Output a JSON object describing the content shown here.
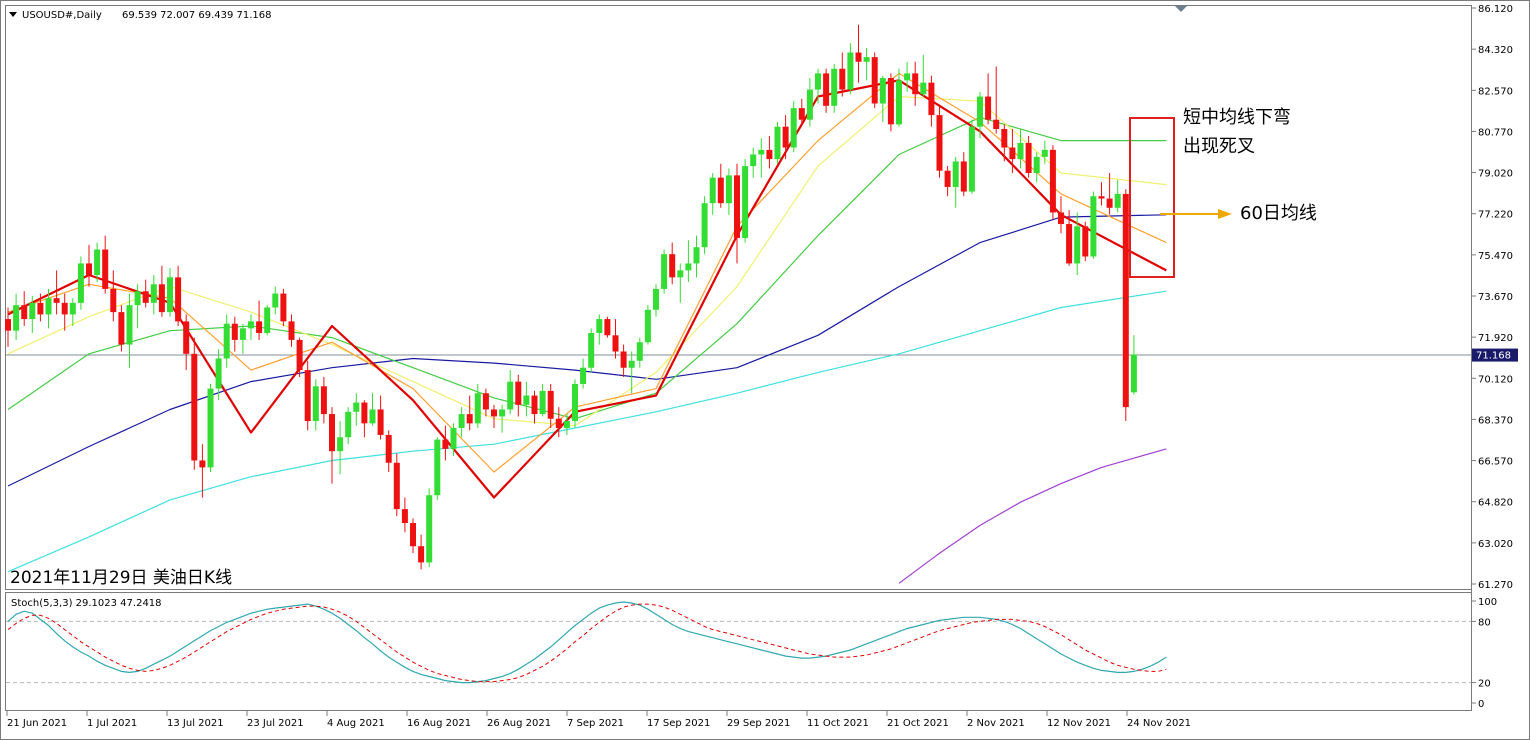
{
  "header": {
    "symbol": "USOUSD#,Daily",
    "ohlc": "69.539 72.007 69.439 71.168"
  },
  "caption": "2021年11月29日 美油日K线",
  "annotations": {
    "box_text_1": "短中均线下弯",
    "box_text_2": "出现死叉",
    "arrow_text": "60日均线"
  },
  "indicator": {
    "label": "Stoch(5,3,3) 29.1023 47.2418",
    "ticks": [
      "100",
      "80",
      "20",
      "0"
    ]
  },
  "price_axis": {
    "ticks": [
      "86.120",
      "84.320",
      "82.570",
      "80.770",
      "79.020",
      "77.220",
      "75.470",
      "73.670",
      "71.920",
      "70.120",
      "68.370",
      "66.570",
      "64.820",
      "63.020",
      "61.270"
    ],
    "current": "71.168"
  },
  "date_axis": {
    "ticks": [
      "21 Jun 2021",
      "1 Jul 2021",
      "13 Jul 2021",
      "23 Jul 2021",
      "4 Aug 2021",
      "16 Aug 2021",
      "26 Aug 2021",
      "7 Sep 2021",
      "17 Sep 2021",
      "29 Sep 2021",
      "11 Oct 2021",
      "21 Oct 2021",
      "2 Nov 2021",
      "12 Nov 2021",
      "24 Nov 2021"
    ]
  },
  "colors": {
    "bull": "#33dd33",
    "bear": "#ee1111",
    "ma5": "#e00000",
    "ma10": "#ffa030",
    "ma20": "#f0f070",
    "ma30": "#44cc44",
    "ma60": "#1a1aa0",
    "ma120": "#40e0e0",
    "ma250": "#a040d0",
    "stoch_main": "#30a8b0",
    "stoch_signal": "#e00000",
    "box": "#e02020",
    "arrow": "#f0a800"
  },
  "chart_data": {
    "type": "candlestick",
    "symbol": "USOUSD#",
    "timeframe": "Daily",
    "last_bar": {
      "open": 69.539,
      "high": 72.007,
      "low": 69.439,
      "close": 71.168
    },
    "ylim": [
      61.27,
      86.12
    ],
    "candles": [
      [
        72.7,
        73.2,
        71.5,
        72.2
      ],
      [
        72.2,
        73.8,
        71.8,
        73.3
      ],
      [
        73.3,
        73.9,
        72.4,
        72.7
      ],
      [
        72.7,
        73.7,
        72.1,
        73.4
      ],
      [
        73.4,
        73.8,
        72.6,
        72.9
      ],
      [
        72.9,
        74.0,
        72.3,
        73.6
      ],
      [
        73.6,
        74.8,
        72.9,
        73.4
      ],
      [
        73.4,
        73.8,
        72.2,
        72.9
      ],
      [
        72.9,
        73.6,
        72.4,
        73.4
      ],
      [
        73.4,
        75.4,
        73.1,
        75.1
      ],
      [
        75.1,
        75.9,
        74.1,
        74.6
      ],
      [
        74.6,
        76.0,
        74.3,
        75.7
      ],
      [
        75.7,
        76.3,
        73.8,
        74.0
      ],
      [
        74.0,
        74.8,
        72.6,
        73.0
      ],
      [
        73.0,
        73.3,
        71.3,
        71.6
      ],
      [
        71.6,
        73.8,
        70.6,
        73.3
      ],
      [
        73.3,
        74.2,
        72.3,
        73.9
      ],
      [
        73.9,
        74.4,
        73.2,
        73.4
      ],
      [
        73.4,
        74.6,
        72.9,
        74.2
      ],
      [
        74.2,
        75.0,
        72.8,
        73.0
      ],
      [
        73.0,
        74.9,
        72.8,
        74.5
      ],
      [
        74.5,
        75.0,
        72.4,
        72.6
      ],
      [
        72.6,
        72.9,
        70.5,
        71.2
      ],
      [
        71.2,
        71.9,
        66.2,
        66.6
      ],
      [
        66.6,
        67.3,
        65.0,
        66.3
      ],
      [
        66.3,
        69.9,
        66.1,
        69.7
      ],
      [
        69.7,
        71.4,
        69.2,
        71.0
      ],
      [
        71.0,
        72.9,
        70.6,
        72.5
      ],
      [
        72.5,
        72.8,
        71.3,
        71.8
      ],
      [
        71.8,
        72.5,
        71.2,
        72.3
      ],
      [
        72.3,
        72.9,
        71.8,
        72.6
      ],
      [
        72.6,
        73.5,
        71.8,
        72.1
      ],
      [
        72.1,
        73.3,
        72.0,
        73.2
      ],
      [
        73.2,
        74.1,
        72.9,
        73.8
      ],
      [
        73.8,
        74.0,
        72.4,
        72.6
      ],
      [
        72.6,
        72.9,
        71.5,
        71.8
      ],
      [
        71.8,
        71.9,
        70.2,
        70.5
      ],
      [
        70.5,
        70.9,
        67.9,
        68.3
      ],
      [
        68.3,
        70.1,
        67.9,
        69.8
      ],
      [
        69.8,
        70.2,
        68.2,
        68.6
      ],
      [
        68.6,
        68.9,
        65.6,
        67.0
      ],
      [
        67.0,
        68.3,
        66.0,
        67.6
      ],
      [
        67.6,
        68.9,
        67.3,
        68.7
      ],
      [
        68.7,
        69.5,
        68.1,
        69.1
      ],
      [
        69.1,
        69.2,
        67.6,
        68.2
      ],
      [
        68.2,
        69.5,
        68.1,
        68.8
      ],
      [
        68.8,
        69.4,
        67.5,
        67.7
      ],
      [
        67.7,
        67.9,
        66.1,
        66.5
      ],
      [
        66.5,
        66.9,
        64.2,
        64.5
      ],
      [
        64.5,
        65.0,
        63.5,
        63.9
      ],
      [
        63.9,
        64.1,
        62.6,
        62.9
      ],
      [
        62.9,
        63.4,
        61.9,
        62.2
      ],
      [
        62.2,
        65.4,
        62.0,
        65.1
      ],
      [
        65.1,
        67.6,
        64.9,
        67.5
      ],
      [
        67.5,
        68.1,
        66.6,
        67.1
      ],
      [
        67.1,
        68.2,
        66.8,
        68.0
      ],
      [
        68.0,
        68.9,
        67.6,
        68.6
      ],
      [
        68.6,
        69.4,
        67.9,
        68.2
      ],
      [
        68.2,
        69.9,
        68.0,
        69.5
      ],
      [
        69.5,
        69.7,
        68.5,
        68.8
      ],
      [
        68.8,
        69.0,
        68.0,
        68.5
      ],
      [
        68.5,
        69.0,
        67.8,
        68.8
      ],
      [
        68.8,
        70.5,
        68.6,
        70.0
      ],
      [
        70.0,
        70.3,
        68.5,
        69.0
      ],
      [
        69.0,
        70.0,
        68.5,
        69.4
      ],
      [
        69.4,
        69.6,
        68.2,
        68.6
      ],
      [
        68.6,
        69.9,
        68.5,
        69.6
      ],
      [
        69.6,
        69.9,
        68.0,
        68.4
      ],
      [
        68.4,
        68.9,
        67.6,
        68.0
      ],
      [
        68.0,
        68.6,
        67.7,
        68.3
      ],
      [
        68.3,
        70.1,
        68.0,
        69.9
      ],
      [
        69.9,
        71.0,
        69.7,
        70.6
      ],
      [
        70.6,
        72.3,
        70.4,
        72.1
      ],
      [
        72.1,
        72.9,
        71.6,
        72.7
      ],
      [
        72.7,
        72.8,
        71.9,
        72.0
      ],
      [
        72.0,
        72.7,
        71.0,
        71.3
      ],
      [
        71.3,
        71.6,
        70.2,
        70.6
      ],
      [
        70.6,
        71.3,
        69.5,
        70.9
      ],
      [
        70.9,
        71.9,
        70.6,
        71.7
      ],
      [
        71.7,
        73.3,
        71.6,
        73.1
      ],
      [
        73.1,
        74.2,
        72.8,
        74.0
      ],
      [
        74.0,
        75.7,
        73.8,
        75.5
      ],
      [
        75.5,
        76.0,
        74.2,
        74.5
      ],
      [
        74.5,
        75.1,
        73.4,
        74.8
      ],
      [
        74.8,
        76.1,
        74.3,
        75.1
      ],
      [
        75.1,
        76.3,
        74.5,
        75.8
      ],
      [
        75.8,
        78.0,
        75.5,
        77.7
      ],
      [
        77.7,
        79.0,
        77.2,
        78.8
      ],
      [
        78.8,
        79.4,
        77.5,
        77.7
      ],
      [
        77.7,
        79.2,
        77.2,
        78.9
      ],
      [
        78.9,
        79.4,
        75.1,
        76.2
      ],
      [
        76.2,
        79.6,
        76.0,
        79.3
      ],
      [
        79.3,
        80.1,
        78.8,
        79.8
      ],
      [
        79.8,
        80.5,
        78.8,
        80.0
      ],
      [
        80.0,
        80.6,
        79.2,
        79.6
      ],
      [
        79.6,
        81.2,
        79.4,
        81.0
      ],
      [
        81.0,
        81.5,
        79.6,
        80.1
      ],
      [
        80.1,
        82.1,
        79.9,
        81.8
      ],
      [
        81.8,
        82.2,
        81.1,
        81.3
      ],
      [
        81.3,
        83.1,
        81.0,
        82.6
      ],
      [
        82.6,
        83.5,
        82.0,
        83.3
      ],
      [
        83.3,
        83.5,
        81.6,
        81.9
      ],
      [
        81.9,
        83.7,
        81.6,
        83.5
      ],
      [
        83.5,
        84.2,
        82.3,
        82.6
      ],
      [
        82.6,
        84.6,
        82.4,
        84.2
      ],
      [
        84.2,
        85.4,
        82.9,
        83.8
      ],
      [
        83.8,
        84.4,
        83.0,
        84.0
      ],
      [
        84.0,
        84.2,
        81.8,
        82.0
      ],
      [
        82.0,
        83.2,
        81.2,
        83.1
      ],
      [
        83.1,
        83.3,
        80.8,
        81.1
      ],
      [
        81.1,
        83.5,
        81.0,
        83.0
      ],
      [
        83.0,
        83.8,
        82.5,
        83.3
      ],
      [
        83.3,
        83.8,
        81.9,
        82.4
      ],
      [
        82.4,
        84.1,
        82.3,
        82.9
      ],
      [
        82.9,
        83.2,
        81.0,
        81.5
      ],
      [
        81.5,
        81.9,
        78.8,
        79.1
      ],
      [
        79.1,
        79.3,
        78.0,
        78.4
      ],
      [
        78.4,
        79.7,
        77.5,
        79.5
      ],
      [
        79.5,
        79.9,
        78.0,
        78.2
      ],
      [
        78.2,
        81.3,
        78.1,
        81.0
      ],
      [
        81.0,
        82.5,
        80.5,
        82.3
      ],
      [
        82.3,
        83.3,
        81.1,
        81.3
      ],
      [
        81.3,
        83.6,
        80.7,
        80.9
      ],
      [
        80.9,
        81.1,
        79.5,
        80.1
      ],
      [
        80.1,
        80.9,
        79.0,
        79.6
      ],
      [
        79.6,
        80.9,
        79.2,
        80.3
      ],
      [
        80.3,
        80.6,
        78.8,
        79.0
      ],
      [
        79.0,
        79.9,
        78.6,
        79.7
      ],
      [
        79.7,
        80.4,
        79.4,
        80.0
      ],
      [
        80.0,
        80.2,
        77.0,
        77.3
      ],
      [
        77.3,
        78.0,
        76.4,
        76.8
      ],
      [
        76.8,
        77.4,
        75.0,
        75.1
      ],
      [
        75.1,
        77.3,
        74.6,
        76.7
      ],
      [
        76.7,
        76.9,
        75.2,
        75.4
      ],
      [
        75.4,
        78.2,
        75.3,
        78.0
      ],
      [
        78.0,
        78.6,
        77.6,
        77.9
      ],
      [
        77.9,
        79.0,
        77.2,
        77.5
      ],
      [
        77.5,
        78.7,
        77.3,
        78.1
      ],
      [
        78.1,
        78.3,
        68.3,
        68.9
      ],
      [
        69.539,
        72.007,
        69.439,
        71.168
      ]
    ],
    "moving_averages": [
      {
        "label": "5",
        "x": [
          0,
          10,
          20,
          30,
          40,
          50,
          60,
          70,
          80,
          90,
          100,
          110,
          120,
          130,
          143
        ],
        "y": [
          72.9,
          74.6,
          73.4,
          67.8,
          72.4,
          69.2,
          65.0,
          68.7,
          69.4,
          76.3,
          82.3,
          83.0,
          80.8,
          77.2,
          74.8
        ]
      },
      {
        "label": "10",
        "x": [
          0,
          10,
          20,
          30,
          40,
          50,
          60,
          70,
          80,
          90,
          100,
          110,
          120,
          130,
          143
        ],
        "y": [
          73.0,
          74.2,
          73.6,
          70.5,
          71.7,
          69.7,
          66.1,
          68.9,
          69.7,
          76.7,
          80.4,
          83.3,
          81.2,
          78.1,
          76.0
        ]
      },
      {
        "label": "20",
        "x": [
          0,
          10,
          20,
          30,
          40,
          50,
          60,
          70,
          80,
          90,
          100,
          110,
          120,
          130,
          143
        ],
        "y": [
          71.2,
          72.8,
          74.1,
          73.0,
          71.6,
          70.0,
          68.4,
          68.1,
          70.4,
          74.1,
          79.3,
          82.3,
          82.1,
          79.0,
          78.5
        ]
      },
      {
        "label": "30",
        "x": [
          0,
          10,
          20,
          30,
          40,
          50,
          60,
          70,
          80,
          90,
          100,
          110,
          120,
          130,
          143
        ],
        "y": [
          68.8,
          71.2,
          72.2,
          72.4,
          71.9,
          70.6,
          69.3,
          68.4,
          69.5,
          72.5,
          76.3,
          79.8,
          81.4,
          80.4,
          80.4
        ]
      },
      {
        "label": "60",
        "x": [
          0,
          10,
          20,
          30,
          40,
          50,
          60,
          70,
          80,
          90,
          100,
          110,
          120,
          130,
          143
        ],
        "y": [
          65.5,
          67.2,
          68.8,
          70.0,
          70.6,
          71.0,
          70.8,
          70.5,
          70.1,
          70.6,
          72.0,
          74.1,
          76.0,
          77.1,
          77.2
        ]
      },
      {
        "label": "120",
        "x": [
          0,
          10,
          20,
          30,
          40,
          50,
          60,
          70,
          80,
          90,
          100,
          110,
          120,
          130,
          143
        ],
        "y": [
          61.8,
          63.3,
          64.9,
          65.9,
          66.6,
          67.0,
          67.3,
          68.0,
          68.7,
          69.5,
          70.4,
          71.2,
          72.2,
          73.2,
          73.9
        ]
      },
      {
        "label": "250",
        "x": [
          110,
          115,
          120,
          125,
          130,
          135,
          140,
          143
        ],
        "y": [
          61.3,
          62.6,
          63.8,
          64.8,
          65.6,
          66.3,
          66.8,
          67.1
        ]
      }
    ],
    "stochastic": {
      "label": "Stoch(5,3,3) 29.1023 47.2418",
      "ylim": [
        0,
        100
      ],
      "levels": [
        20,
        80
      ],
      "main": [
        80,
        87,
        90,
        88,
        82,
        76,
        68,
        61,
        55,
        50,
        46,
        41,
        37,
        34,
        31,
        30,
        31,
        34,
        38,
        42,
        46,
        51,
        56,
        61,
        66,
        71,
        75,
        79,
        82,
        85,
        88,
        90,
        92,
        93,
        94,
        95,
        96,
        97,
        95,
        92,
        88,
        83,
        77,
        71,
        64,
        58,
        51,
        45,
        40,
        35,
        31,
        28,
        26,
        24,
        22,
        21,
        20,
        20,
        21,
        22,
        24,
        26,
        29,
        33,
        38,
        43,
        49,
        55,
        62,
        69,
        76,
        82,
        88,
        93,
        96,
        98,
        99,
        98,
        96,
        92,
        87,
        82,
        77,
        73,
        70,
        68,
        66,
        64,
        62,
        60,
        58,
        56,
        54,
        52,
        50,
        48,
        46,
        45,
        44,
        44,
        45,
        46,
        48,
        50,
        52,
        55,
        58,
        61,
        64,
        67,
        70,
        73,
        75,
        77,
        79,
        81,
        82,
        83,
        84,
        84,
        84,
        83,
        82,
        80,
        77,
        73,
        68,
        63,
        58,
        53,
        48,
        44,
        40,
        37,
        34,
        32,
        31,
        30,
        30,
        31,
        33,
        36,
        40,
        45
      ],
      "signal": [
        72,
        78,
        83,
        86,
        86,
        83,
        78,
        72,
        66,
        60,
        55,
        50,
        45,
        41,
        37,
        34,
        32,
        31,
        32,
        34,
        37,
        41,
        45,
        50,
        55,
        60,
        65,
        70,
        74,
        78,
        82,
        85,
        88,
        90,
        92,
        93,
        94,
        95,
        95,
        94,
        92,
        89,
        85,
        80,
        74,
        68,
        62,
        56,
        50,
        45,
        40,
        36,
        32,
        29,
        27,
        25,
        23,
        22,
        21,
        21,
        21,
        22,
        23,
        25,
        28,
        32,
        36,
        41,
        47,
        53,
        60,
        66,
        73,
        79,
        85,
        90,
        94,
        96,
        97,
        97,
        96,
        94,
        91,
        87,
        83,
        79,
        75,
        72,
        70,
        68,
        66,
        64,
        62,
        60,
        58,
        56,
        54,
        52,
        50,
        48,
        47,
        46,
        45,
        45,
        45,
        46,
        47,
        49,
        51,
        53,
        56,
        59,
        62,
        65,
        68,
        71,
        73,
        75,
        77,
        79,
        80,
        81,
        82,
        82,
        82,
        81,
        80,
        78,
        75,
        71,
        67,
        62,
        57,
        52,
        48,
        44,
        40,
        37,
        35,
        33,
        32,
        31,
        31,
        33
      ]
    }
  }
}
